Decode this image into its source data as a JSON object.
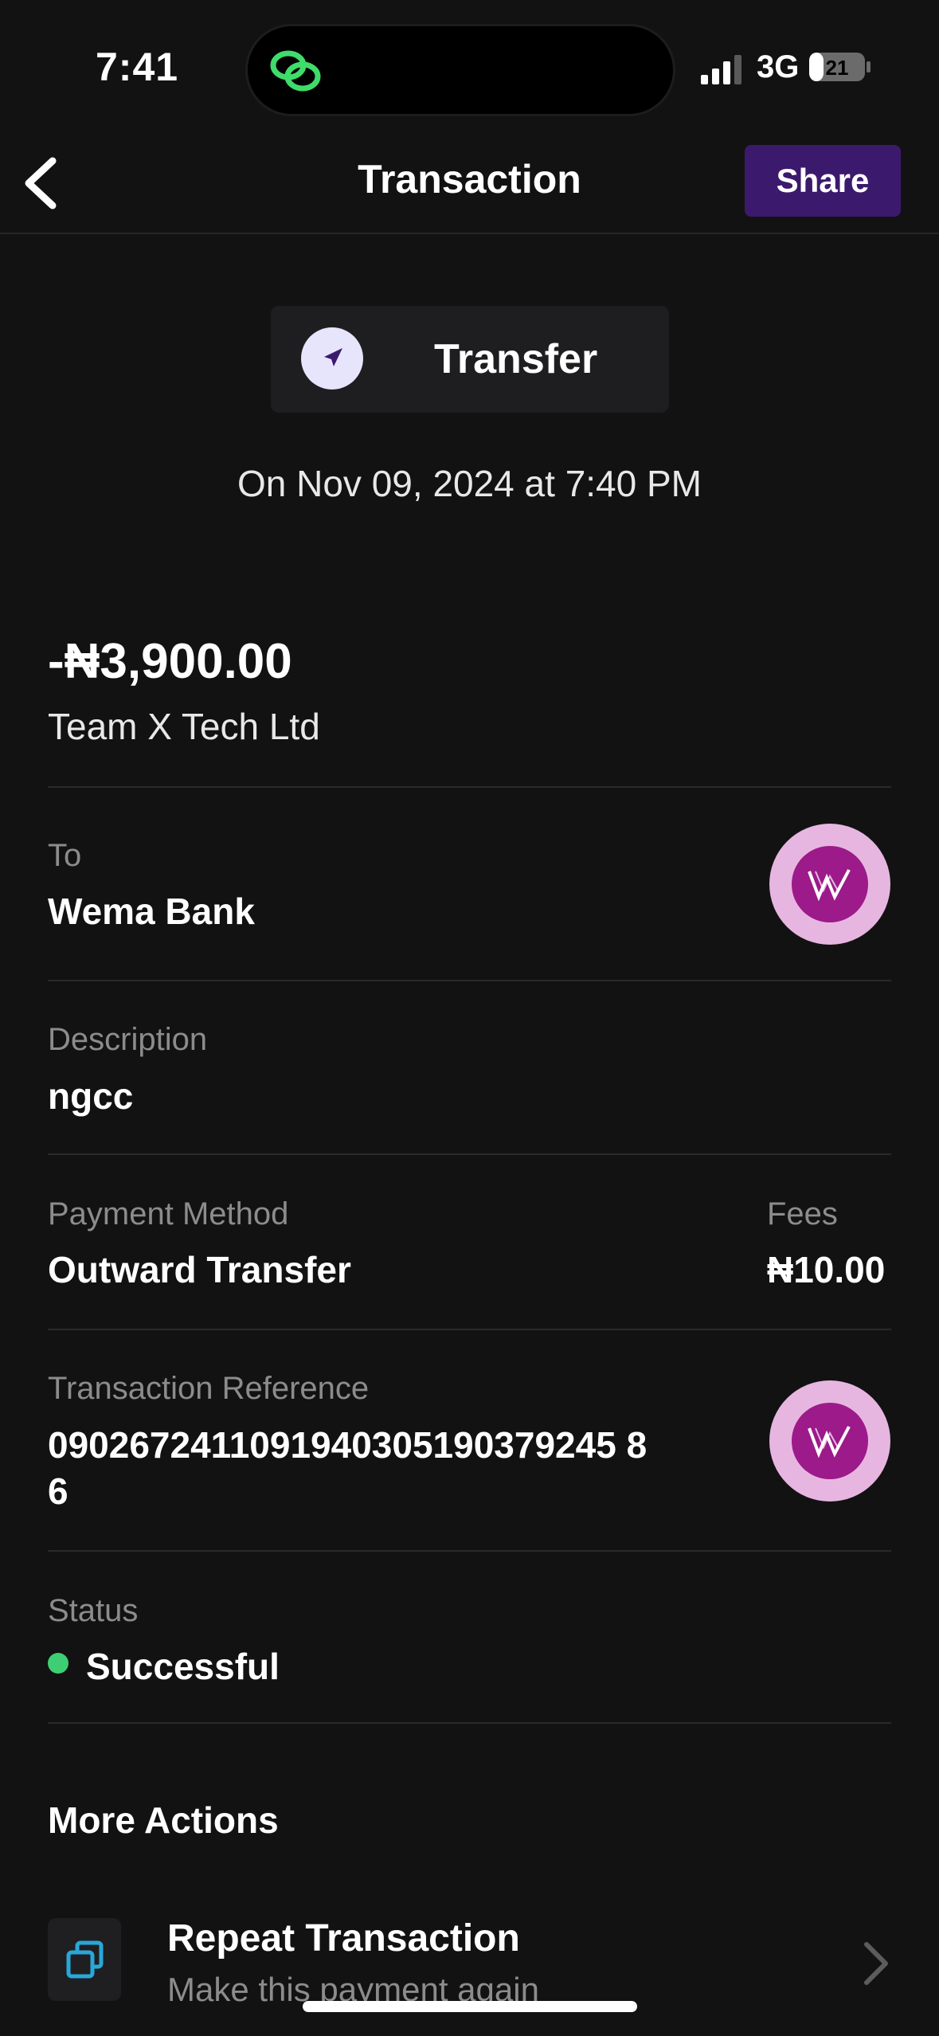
{
  "status_bar": {
    "time": "7:41",
    "network": "3G",
    "battery": "21"
  },
  "header": {
    "title": "Transaction",
    "share_label": "Share"
  },
  "transaction": {
    "type": "Transfer",
    "datetime": "On Nov 09, 2024 at 7:40 PM",
    "amount": "-₦3,900.00",
    "merchant": "Team X Tech Ltd"
  },
  "details": {
    "to_label": "To",
    "to_value": "Wema Bank",
    "description_label": "Description",
    "description_value": "ngcc",
    "payment_method_label": "Payment Method",
    "payment_method_value": "Outward Transfer",
    "fees_label": "Fees",
    "fees_value": "₦10.00",
    "reference_label": "Transaction Reference",
    "reference_value_line1": "0902672411091940305190379245 8",
    "reference_value_line2": "6",
    "status_label": "Status",
    "status_value": "Successful"
  },
  "more_actions": {
    "heading": "More Actions",
    "repeat_title": "Repeat Transaction",
    "repeat_subtitle": "Make this payment again"
  },
  "icons": {
    "back": "chevron-left-icon",
    "transfer": "send-arrow-icon",
    "bank": "wema-bank-logo",
    "repeat": "copy-icon",
    "chevron": "chevron-right-icon"
  },
  "colors": {
    "background": "#121212",
    "accent": "#3b1a6e",
    "success": "#3ecf74",
    "muted_text": "#8c8c8c"
  }
}
